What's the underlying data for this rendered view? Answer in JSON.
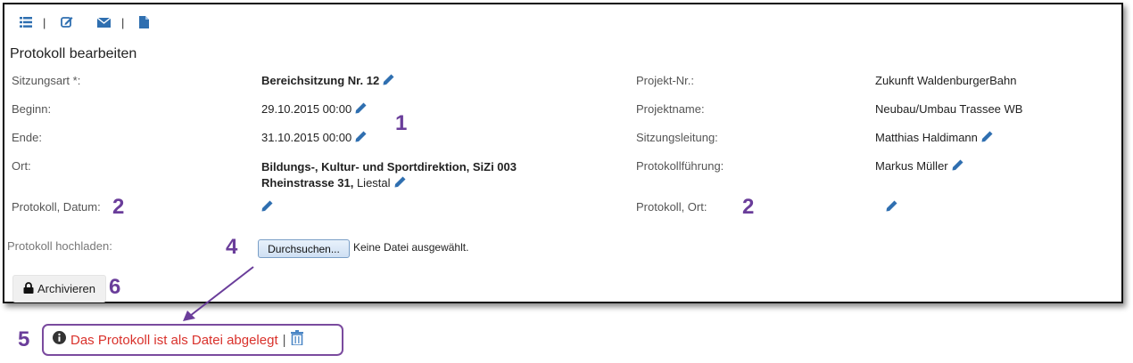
{
  "toolbar": {
    "icons": [
      "list-icon",
      "edit-icon",
      "mail-icon",
      "document-icon"
    ],
    "separator": "|"
  },
  "page_title": "Protokoll bearbeiten",
  "fields_left": [
    {
      "label": "Sitzungsart *:",
      "value": "Bereichsitzung Nr. 12"
    },
    {
      "label": "Beginn:",
      "value": "29.10.2015 00:00"
    },
    {
      "label": "Ende:",
      "value": "31.10.2015 00:00"
    },
    {
      "label": "Ort:",
      "value_line1": "Bildungs-, Kultur- und Sportdirektion, SiZi 003",
      "value_line2_bold": "Rheinstrasse 31,",
      "value_line2_rest": " Liestal"
    },
    {
      "label": "Protokoll, Datum:",
      "value": ""
    }
  ],
  "fields_right": [
    {
      "label": "Projekt-Nr.:",
      "value": "Zukunft WaldenburgerBahn"
    },
    {
      "label": "Projektname:",
      "value": "Neubau/Umbau Trassee WB"
    },
    {
      "label": "Sitzungsleitung:",
      "value": "Matthias Haldimann"
    },
    {
      "label": "Protokollführung:",
      "value": "Markus Müller"
    },
    {
      "label": "Protokoll, Ort:",
      "value": ""
    }
  ],
  "upload": {
    "label": "Protokoll hochladen:",
    "button": "Durchsuchen...",
    "status": "Keine Datei ausgewählt."
  },
  "archive_button": "Archivieren",
  "info": {
    "message": "Das Protokoll ist als Datei abgelegt",
    "separator": "|"
  },
  "annotations": {
    "n1": "1",
    "n2": "2",
    "n4": "4",
    "n5": "5",
    "n6": "6"
  },
  "colors": {
    "accent": "#2f6fb0",
    "annotation": "#6a3d9a",
    "message": "#d9312b",
    "border": "#111111"
  }
}
